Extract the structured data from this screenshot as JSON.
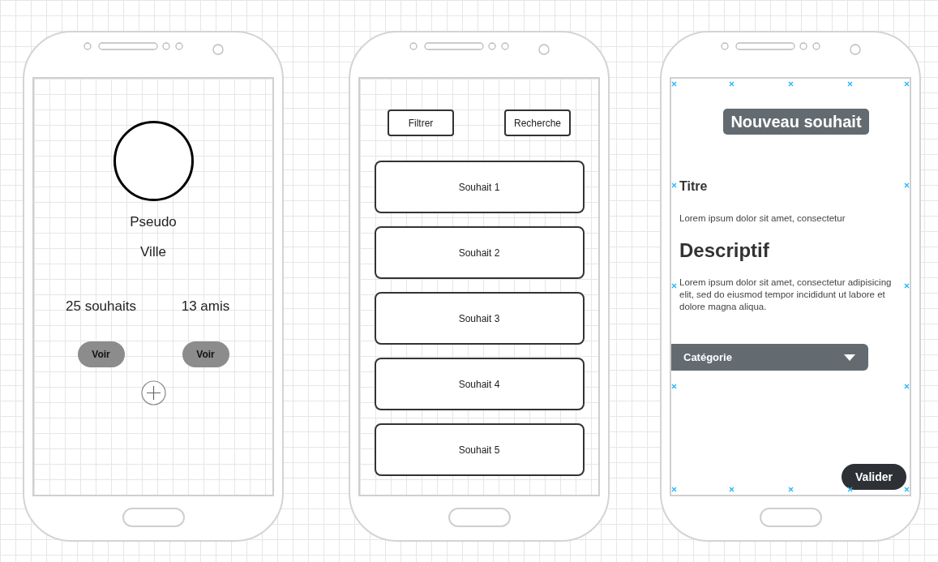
{
  "profile": {
    "pseudo": "Pseudo",
    "city": "Ville",
    "stats": [
      {
        "label": "25 souhaits",
        "button": "Voir"
      },
      {
        "label": "13 amis",
        "button": "Voir"
      }
    ]
  },
  "wishlist": {
    "buttons": [
      "Filtrer",
      "Recherche"
    ],
    "items": [
      "Souhait 1",
      "Souhait 2",
      "Souhait 3",
      "Souhait 4",
      "Souhait 5"
    ]
  },
  "new_wish": {
    "title": "Nouveau souhait",
    "fields": [
      {
        "kind": "minor",
        "label": "Titre",
        "text": "Lorem ipsum dolor sit amet, consectetur"
      },
      {
        "kind": "major",
        "label": "Descriptif",
        "text": "Lorem ipsum dolor sit amet, consectetur adipisicing elit, sed do eiusmod tempor incididunt ut labore et dolore magna aliqua."
      }
    ],
    "dropdown": {
      "label": "Catégorie"
    },
    "submit": "Valider"
  }
}
